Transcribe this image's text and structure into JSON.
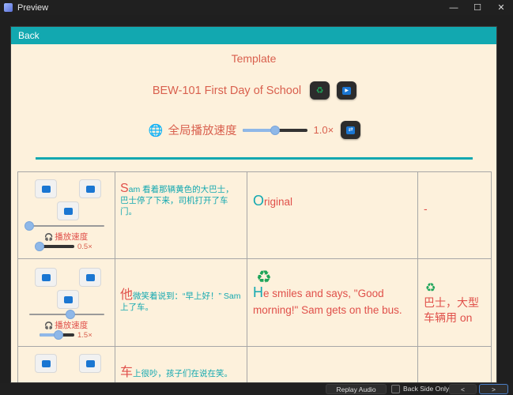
{
  "window": {
    "title": "Preview",
    "minimize_glyph": "—",
    "maximize_glyph": "☐",
    "close_glyph": "✕"
  },
  "header": {
    "back_label": "Back",
    "template_title": "Template",
    "deck_name": "BEW-101 First Day of School",
    "recycle_glyph": "♻",
    "play_glyph": "▶"
  },
  "speed": {
    "globe_glyph": "🌐",
    "label": "全局播放速度",
    "value": "1.0×",
    "level": 0.5,
    "repeat_glyph": "⇄"
  },
  "rows": [
    {
      "speed_label": "播放速度",
      "speed_value": "0.5×",
      "progress": 0.0,
      "speed_level": 0.0,
      "front_first": "S",
      "front_rest": "am 看着那辆黄色的大巴士，巴士停了下来，司机打开了车门。",
      "back_first": "O",
      "back_rest": "riginal",
      "back_icon": "",
      "extra_icon": "",
      "extra": "-"
    },
    {
      "speed_label": "播放速度",
      "speed_value": "1.5×",
      "progress": 0.55,
      "speed_level": 0.55,
      "front_first": "他",
      "front_rest": "微笑着说到：“早上好！” Sam 上了车。",
      "back_icon": "♻",
      "back_first": "H",
      "back_rest": "e smiles and says, \"Good morning!\" Sam gets on the bus.",
      "extra_icon": "♻",
      "extra": "巴士，大型车辆用 on"
    },
    {
      "speed_label": "",
      "speed_value": "",
      "progress": 0.0,
      "speed_level": 0.0,
      "front_first": "车",
      "front_rest": "上很吵，孩子们在说在笑。",
      "back_icon": "",
      "back_first": "",
      "back_rest": "",
      "extra_icon": "",
      "extra": ""
    }
  ],
  "bottom": {
    "replay_label": "Replay Audio",
    "back_side_only_label": "Back Side Only",
    "prev_glyph": "<",
    "next_glyph": ">"
  },
  "colors": {
    "accent": "#12a8b0",
    "text_red": "#d9604e",
    "card_bg": "#fdf1dc",
    "slider": "#8fb8e8"
  }
}
